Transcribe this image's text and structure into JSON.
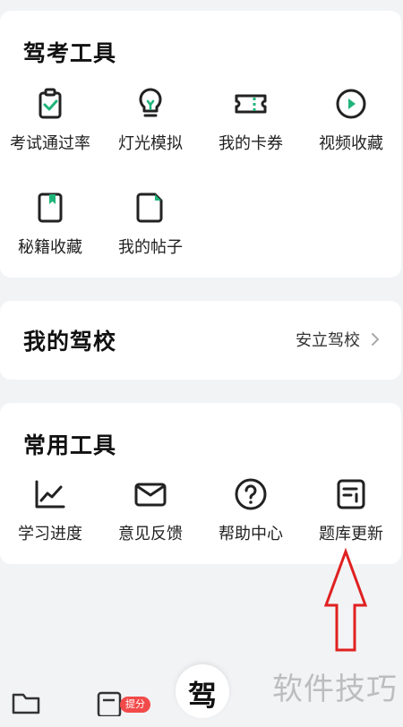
{
  "drive_tools": {
    "title": "驾考工具",
    "items": [
      {
        "label": "考试通过率",
        "icon": "clipboard-check-icon"
      },
      {
        "label": "灯光模拟",
        "icon": "lightbulb-icon"
      },
      {
        "label": "我的卡券",
        "icon": "ticket-icon"
      },
      {
        "label": "视频收藏",
        "icon": "play-circle-icon"
      },
      {
        "label": "秘籍收藏",
        "icon": "bookmark-book-icon"
      },
      {
        "label": "我的帖子",
        "icon": "document-icon"
      }
    ]
  },
  "my_school": {
    "title": "我的驾校",
    "value": "安立驾校"
  },
  "common_tools": {
    "title": "常用工具",
    "items": [
      {
        "label": "学习进度",
        "icon": "line-chart-icon"
      },
      {
        "label": "意见反馈",
        "icon": "envelope-icon"
      },
      {
        "label": "帮助中心",
        "icon": "help-circle-icon"
      },
      {
        "label": "题库更新",
        "icon": "question-bank-update-icon"
      }
    ]
  },
  "bottom_nav": {
    "badge": "提分",
    "center_label": "驾"
  },
  "watermark": "软件技巧",
  "colors": {
    "accent": "#1fb57a",
    "icon_stroke": "#222222",
    "arrow": "#e02020",
    "badge": "#f24a4a"
  }
}
